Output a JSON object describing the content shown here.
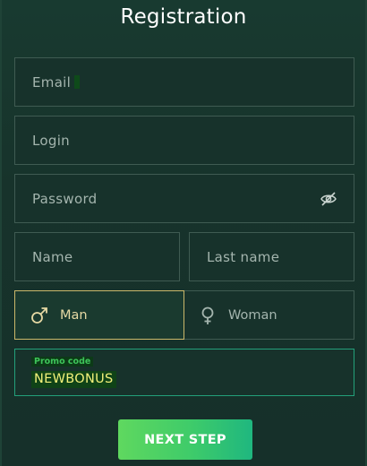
{
  "form": {
    "title": "Registration",
    "email": {
      "placeholder": "Email",
      "value": ""
    },
    "login": {
      "placeholder": "Login",
      "value": ""
    },
    "password": {
      "placeholder": "Password",
      "value": "",
      "icon": "eye-off-icon"
    },
    "first_name": {
      "placeholder": "Name",
      "value": ""
    },
    "last_name": {
      "placeholder": "Last name",
      "value": ""
    },
    "gender": {
      "options": [
        {
          "label": "Man",
          "icon": "male-icon",
          "selected": true
        },
        {
          "label": "Woman",
          "icon": "female-icon",
          "selected": false
        }
      ]
    },
    "promo": {
      "label": "Promo code",
      "value": "NEWBONUS"
    },
    "next_button": {
      "label": "NEXT STEP"
    }
  },
  "colors": {
    "background": "#16302a",
    "field_border": "#3f5b52",
    "selected_border": "#cbb86a",
    "promo_border": "#23a07a",
    "button_start": "#5fd85f",
    "button_end": "#1fb77f",
    "promo_value": "#f2f07a"
  }
}
